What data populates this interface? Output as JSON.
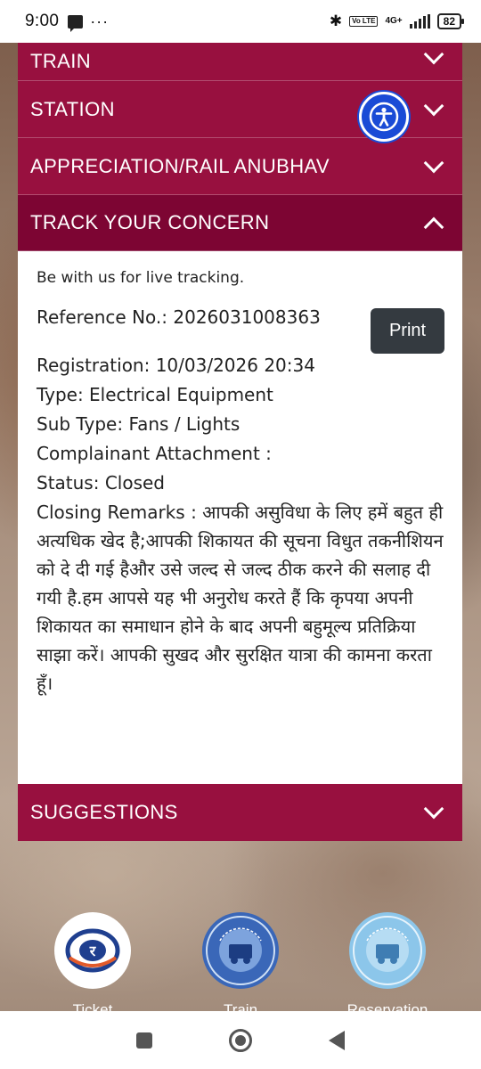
{
  "status_bar": {
    "time": "9:00",
    "dots": "···",
    "network": "4G+",
    "volte": "Vo LTE",
    "battery": "82"
  },
  "accordion": [
    {
      "label": "TRAIN",
      "state": "collapsed"
    },
    {
      "label": "STATION",
      "state": "collapsed"
    },
    {
      "label": "APPRECIATION/RAIL ANUBHAV",
      "state": "collapsed"
    },
    {
      "label": "TRACK YOUR CONCERN",
      "state": "expanded"
    },
    {
      "label": "SUGGESTIONS",
      "state": "collapsed"
    }
  ],
  "concern": {
    "intro": "Be with us for live tracking.",
    "reference": "Reference No.: 2026031008363",
    "print_label": "Print",
    "registration": "Registration: 10/03/2026 20:34",
    "type": "Type: Electrical Equipment",
    "sub_type": "Sub Type: Fans / Lights",
    "attachment": "Complainant Attachment :",
    "status": "Status: Closed",
    "remarks": "Closing Remarks : आपकी असुविधा के लिए हमें बहुत ही अत्यधिक खेद है;आपकी शिकायत की सूचना विधुत तकनीशियन को दे दी गई हैऔर उसे जल्द से जल्द ठीक करने की सलाह दी गयी है.हम आपसे यह भी अनुरोध करते हैं कि कृपया अपनी शिकायत का समाधान होने के बाद अपनी बहुमूल्य प्रतिक्रिया साझा करें। आपकी सुखद और सुरक्षित यात्रा की कामना करता हूँ।"
  },
  "bottom_tiles": [
    {
      "label": "Ticket"
    },
    {
      "label": "Train"
    },
    {
      "label": "Reservation"
    }
  ],
  "colors": {
    "accordion_bg": "#98103f",
    "accordion_active_bg": "#7d0533",
    "accessibility_blue": "#1a4bd6"
  }
}
